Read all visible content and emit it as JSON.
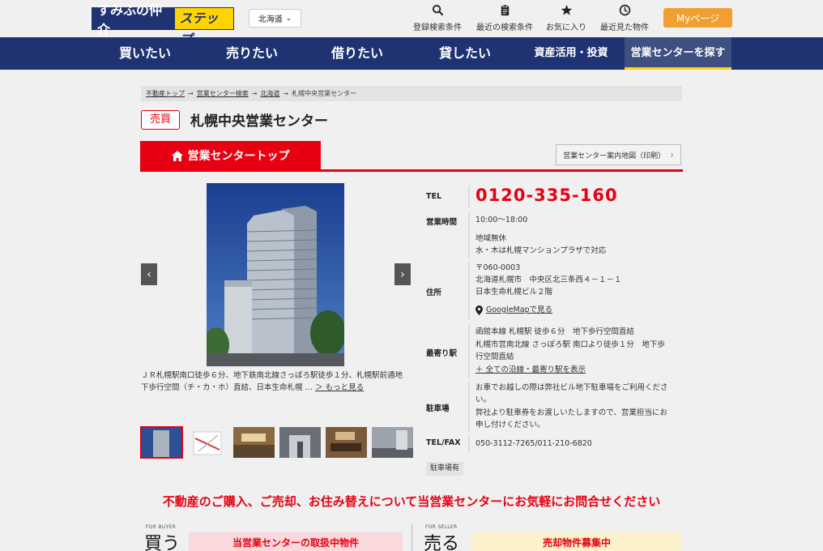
{
  "header": {
    "logo_main": "すみふの仲介",
    "logo_sub": "ステップ",
    "region": "北海道",
    "links": [
      {
        "label": "登録検索条件",
        "icon": "search-icon"
      },
      {
        "label": "最近の検索条件",
        "icon": "clipboard-icon"
      },
      {
        "label": "お気に入り",
        "icon": "star-icon"
      },
      {
        "label": "最近見た物件",
        "icon": "clock-icon"
      }
    ],
    "mypage": "Myページ"
  },
  "nav": {
    "items": [
      "買いたい",
      "売りたい",
      "借りたい",
      "貸したい",
      "資産活用・投資",
      "営業センターを探す"
    ]
  },
  "breadcrumb": {
    "items": [
      "不動産トップ",
      "営業センター検索",
      "北海道",
      "札幌中央営業センター"
    ],
    "sep": "→"
  },
  "title": {
    "badge": "売買",
    "name": "札幌中央営業センター"
  },
  "tabs": {
    "active": "営業センタートップ",
    "map_button": "営業センター案内地図（印刷）"
  },
  "gallery": {
    "caption": "ＪＲ札幌駅南口徒歩６分、地下鉄南北線さっぽろ駅徒歩１分、札幌駅前通地下歩行空間（チ・カ・ホ）直結、日本生命札幌 …",
    "more_link": "＞ もっと見る",
    "prev": "‹",
    "next": "›"
  },
  "info": {
    "tel_label": "TEL",
    "tel": "0120-335-160",
    "hours_label": "営業時間",
    "hours": "10:00〜18:00",
    "holidays_1": "地域無休",
    "holidays_2": "水・木は札幌マンションプラザで対応",
    "address_label": "住所",
    "postal": "〒060-0003",
    "address_1": "北海道札幌市　中央区北三条西４－１－１",
    "address_2": "日本生命札幌ビル２階",
    "gmap": "GoogleMapで見る",
    "station_label": "最寄り駅",
    "station_1": "函館本線 札幌駅 徒歩６分　地下歩行空間直結",
    "station_2": "札幌市営南北線 さっぽろ駅 南口より徒歩１分　地下歩",
    "station_3": "行空間直結",
    "station_all": "＋ 全ての沿線・最寄り駅を表示",
    "parking_label": "駐車場",
    "parking_1": "お車でお越しの際は弊社ビル地下駐車場をご利用くださ",
    "parking_2": "い。",
    "parking_3": "弊社より駐車券をお渡しいたしますので、営業担当にお",
    "parking_4": "申し付けください。",
    "telfax_label": "TEL/FAX",
    "telfax": "050-3112-7265/011-210-6820",
    "parking_tag": "駐車場有"
  },
  "cta": "不動産のご購入、ご売却、お住み替えについて当営業センターにお気軽にお問合せください",
  "bottom": {
    "buyer_tag": "FOR BUYER",
    "buyer_big": "買う",
    "buyer_box": "当営業センターの取扱中物件",
    "seller_tag": "FOR SELLER",
    "seller_big": "売る",
    "seller_box": "売却物件募集中"
  }
}
